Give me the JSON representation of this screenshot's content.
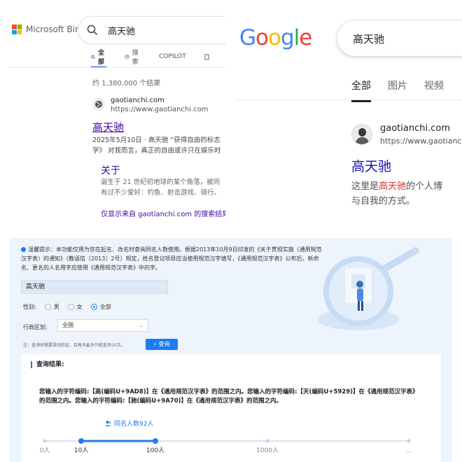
{
  "bing": {
    "brand": "Microsoft Bing",
    "query": "高天驰",
    "tabs": [
      {
        "label": "全部",
        "icon": "search-icon",
        "active": true
      },
      {
        "label": "搜索",
        "icon": "copilot-chat-icon",
        "active": false
      },
      {
        "label": "COPILOT",
        "icon": "",
        "active": false
      }
    ],
    "result_count": "约 1,380,000 个结果",
    "result": {
      "domain": "gaotianchi.com",
      "url": "https://www.gaotianchi.com",
      "title": "高天驰",
      "snippet_line1": "2025年5月10日 · 高天驰 “获得自由的标志",
      "snippet_line2": "学》 对我而言，真正的自由或许只在娱乐时"
    },
    "sublink": {
      "title": "关于",
      "snippet_line1": "诞生于 21 世纪初地球的某个角落，被同",
      "snippet_line2": "有过不少爱好：钓鱼、射击游戏、骑行、"
    },
    "only_show": "仅显示来自 gaotianchi.com 的搜索结果"
  },
  "google": {
    "logo_letters": [
      "G",
      "o",
      "o",
      "g",
      "l",
      "e"
    ],
    "logo_colors": [
      "#4285F4",
      "#EA4335",
      "#FBBC05",
      "#4285F4",
      "#34A853",
      "#EA4335"
    ],
    "query": "高天驰",
    "tabs": [
      {
        "label": "全部",
        "active": true
      },
      {
        "label": "图片",
        "active": false
      },
      {
        "label": "视频",
        "active": false
      }
    ],
    "result": {
      "domain": "gaotianchi.com",
      "url": "https://www.gaotianchi.com",
      "title": "高天驰",
      "snippet_pre": "这里是",
      "snippet_highlight": "高天驰",
      "snippet_post": "的个人博",
      "snippet_line2": "与自我的方式。"
    }
  },
  "namequery": {
    "tip": "温馨提示：本功能仅用为您在起名、改名时查询同名人数使用。根据2013年10月9日印发的《关于贯彻实施〈通用规范汉字表〉的通知》（教语信〔2013〕2号）规定，姓名登记项目应当使用规范汉字填写，《通用规范汉字表》公布后，新命名、更名的人名用字应使用《通用规范汉字表》中的字。",
    "name_value": "高天驰",
    "gender_label": "性别:",
    "gender_options": [
      "男",
      "女",
      "全部"
    ],
    "gender_selected": "全部",
    "region_label": "行政区划:",
    "region_value": "全国",
    "note": "注：查询时需要滑动验证，且每天最多只能查询10次。",
    "query_button": "查询",
    "result_heading": "查询结果:",
    "result_text": "您输入的字符编码:【高(编码U+9AD8)】在《通用规范汉字表》的范围之内。您输入的字符编码:【天(编码U+5929)】在《通用规范汉字表》的范围之内。您输入的字符编码:【驰(编码U+9A70)】在《通用规范汉字表》的范围之内。",
    "same_name_count": "同名人数92人",
    "scale_labels": [
      "0人",
      "10人",
      "100人",
      "1000人",
      "…"
    ]
  }
}
